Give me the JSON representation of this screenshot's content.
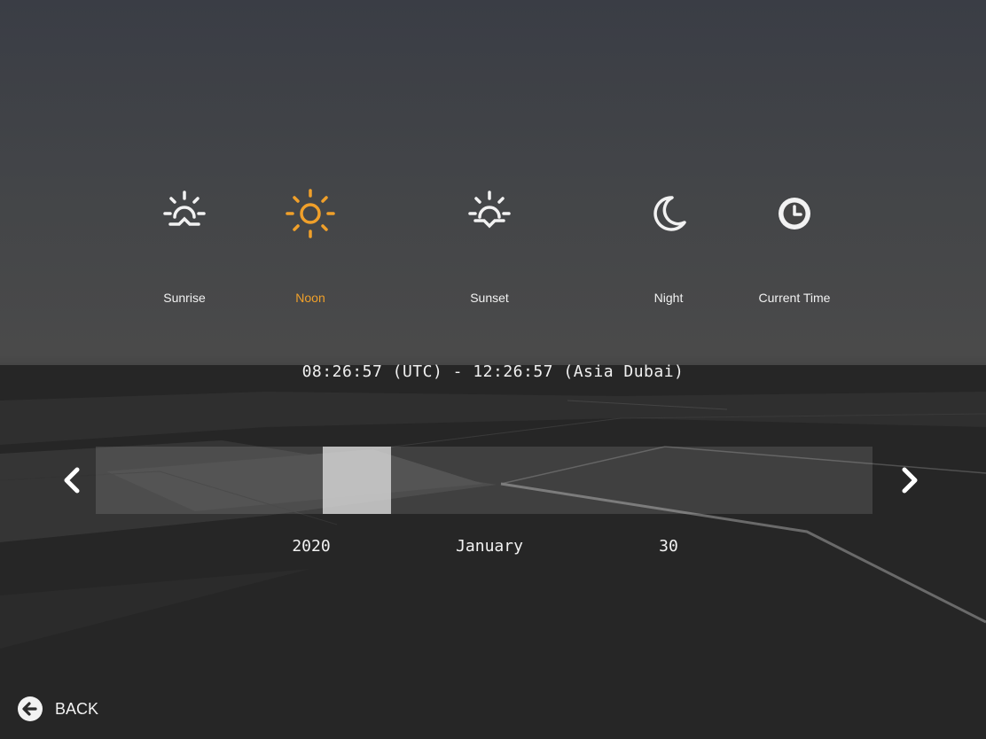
{
  "time_presets": [
    {
      "label": "Sunrise",
      "icon": "sunrise-icon",
      "active": false
    },
    {
      "label": "Noon",
      "icon": "sun-icon",
      "active": true
    },
    {
      "label": "Sunset",
      "icon": "sunset-icon",
      "active": false
    },
    {
      "label": "Night",
      "icon": "moon-icon",
      "active": false
    },
    {
      "label": "Current Time",
      "icon": "clock-icon",
      "active": false
    }
  ],
  "time_readout": "08:26:57 (UTC) - 12:26:57 (Asia Dubai)",
  "slider": {
    "position_fraction": 0.32
  },
  "date": {
    "year": "2020",
    "month": "January",
    "day": "30"
  },
  "back": {
    "label": "BACK",
    "icon": "back-arrow-icon"
  },
  "colors": {
    "accent": "#f0a02a",
    "text": "#f2f2f2"
  }
}
